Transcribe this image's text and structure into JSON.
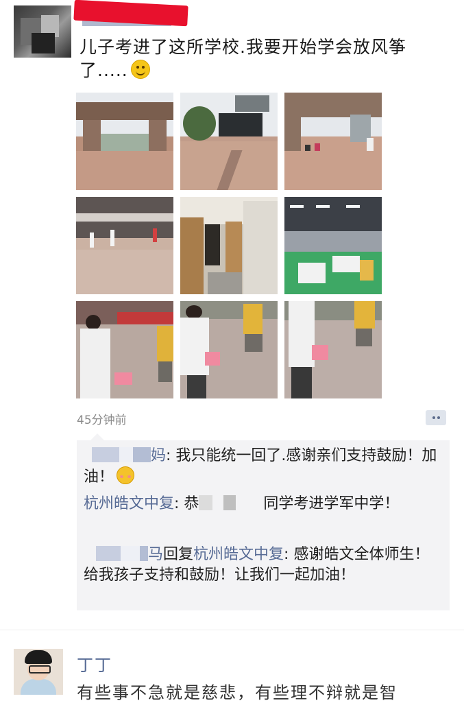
{
  "post": {
    "text": "儿子考进了这所学校.我要开始学会放风筝了.....",
    "emoji": "smile-emoji",
    "time": "45分钟前",
    "photos": [
      {
        "name": "school-gate-photo"
      },
      {
        "name": "campus-screen-photo"
      },
      {
        "name": "gate-crowd-photo"
      },
      {
        "name": "building-walk-photo"
      },
      {
        "name": "dorm-room-photo"
      },
      {
        "name": "cafeteria-photo"
      },
      {
        "name": "boys-walking-photo-1"
      },
      {
        "name": "boys-walking-photo-2"
      },
      {
        "name": "boys-walking-photo-3"
      }
    ]
  },
  "comments": [
    {
      "nick_visible": "妈",
      "text": ": 我只能统一回了.感谢亲们支持鼓励！加油！"
    },
    {
      "nick": "杭州皓文中复",
      "text_a": ": 恭",
      "text_b": "同学考进学军中学！"
    },
    {
      "nick_visible": "马",
      "reply_word": "回复",
      "reply_to": "杭州皓文中复",
      "text": ": 感谢皓文全体师生！给我孩子支持和鼓励！让我们一起加油！"
    }
  ],
  "next_post": {
    "name": "丁丁",
    "text": "有些事不急就是慈悲，有些理不辩就是智"
  },
  "colors": {
    "nick": "#576b95",
    "redact": "#e8112d",
    "comment_bg": "#f3f3f5"
  }
}
